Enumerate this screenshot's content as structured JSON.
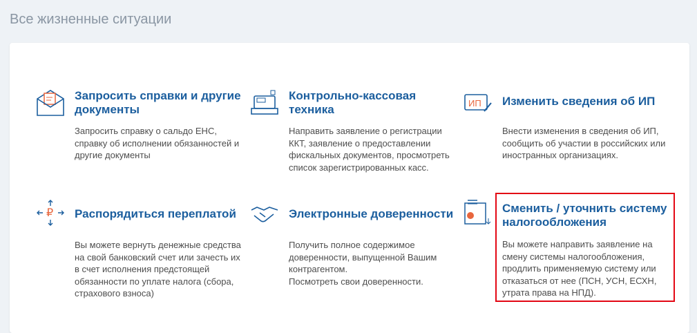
{
  "page_title": "Все жизненные ситуации",
  "items": [
    {
      "title": "Запросить справки и другие документы",
      "desc": "Запросить справку о сальдо ЕНС, справку об исполнении обязанностей и другие документы",
      "icon": "envelope-document-icon"
    },
    {
      "title": "Контрольно-кассовая техника",
      "desc": "Направить заявление о регистрации ККТ, заявление о предоставлении фискальных документов, просмотреть список зарегистрированных касс.",
      "icon": "cash-register-icon"
    },
    {
      "title": "Изменить сведения об ИП",
      "desc": "Внести изменения в сведения об ИП, сообщить об участии в российских или иностранных организациях.",
      "icon": "ip-edit-icon",
      "icon_text": "ИП"
    },
    {
      "title": "Распорядиться переплатой",
      "desc": "Вы можете вернуть денежные средства на свой банковский счет или зачесть их в счет исполнения предстоящей обязанности по уплате налога (сбора, страхового взноса)",
      "icon": "ruble-arrows-icon",
      "icon_text": "₽"
    },
    {
      "title": "Электронные доверенности",
      "desc": "Получить полное содержимое доверенности, выпущенной Вашим контрагентом.\nПосмотреть свои доверенности.",
      "icon": "handshake-icon"
    },
    {
      "title": "Сменить / уточнить систему налогообложения",
      "desc": "Вы можете направить заявление на смену системы налогообложения, продлить применяемую систему или отказаться от нее (ПСН, УСН, ЕСХН, утрата права на НПД).",
      "icon": "tax-system-document-icon"
    }
  ],
  "colors": {
    "title": "#1b5e9e",
    "accent": "#e8663d",
    "highlight": "#e30613"
  }
}
